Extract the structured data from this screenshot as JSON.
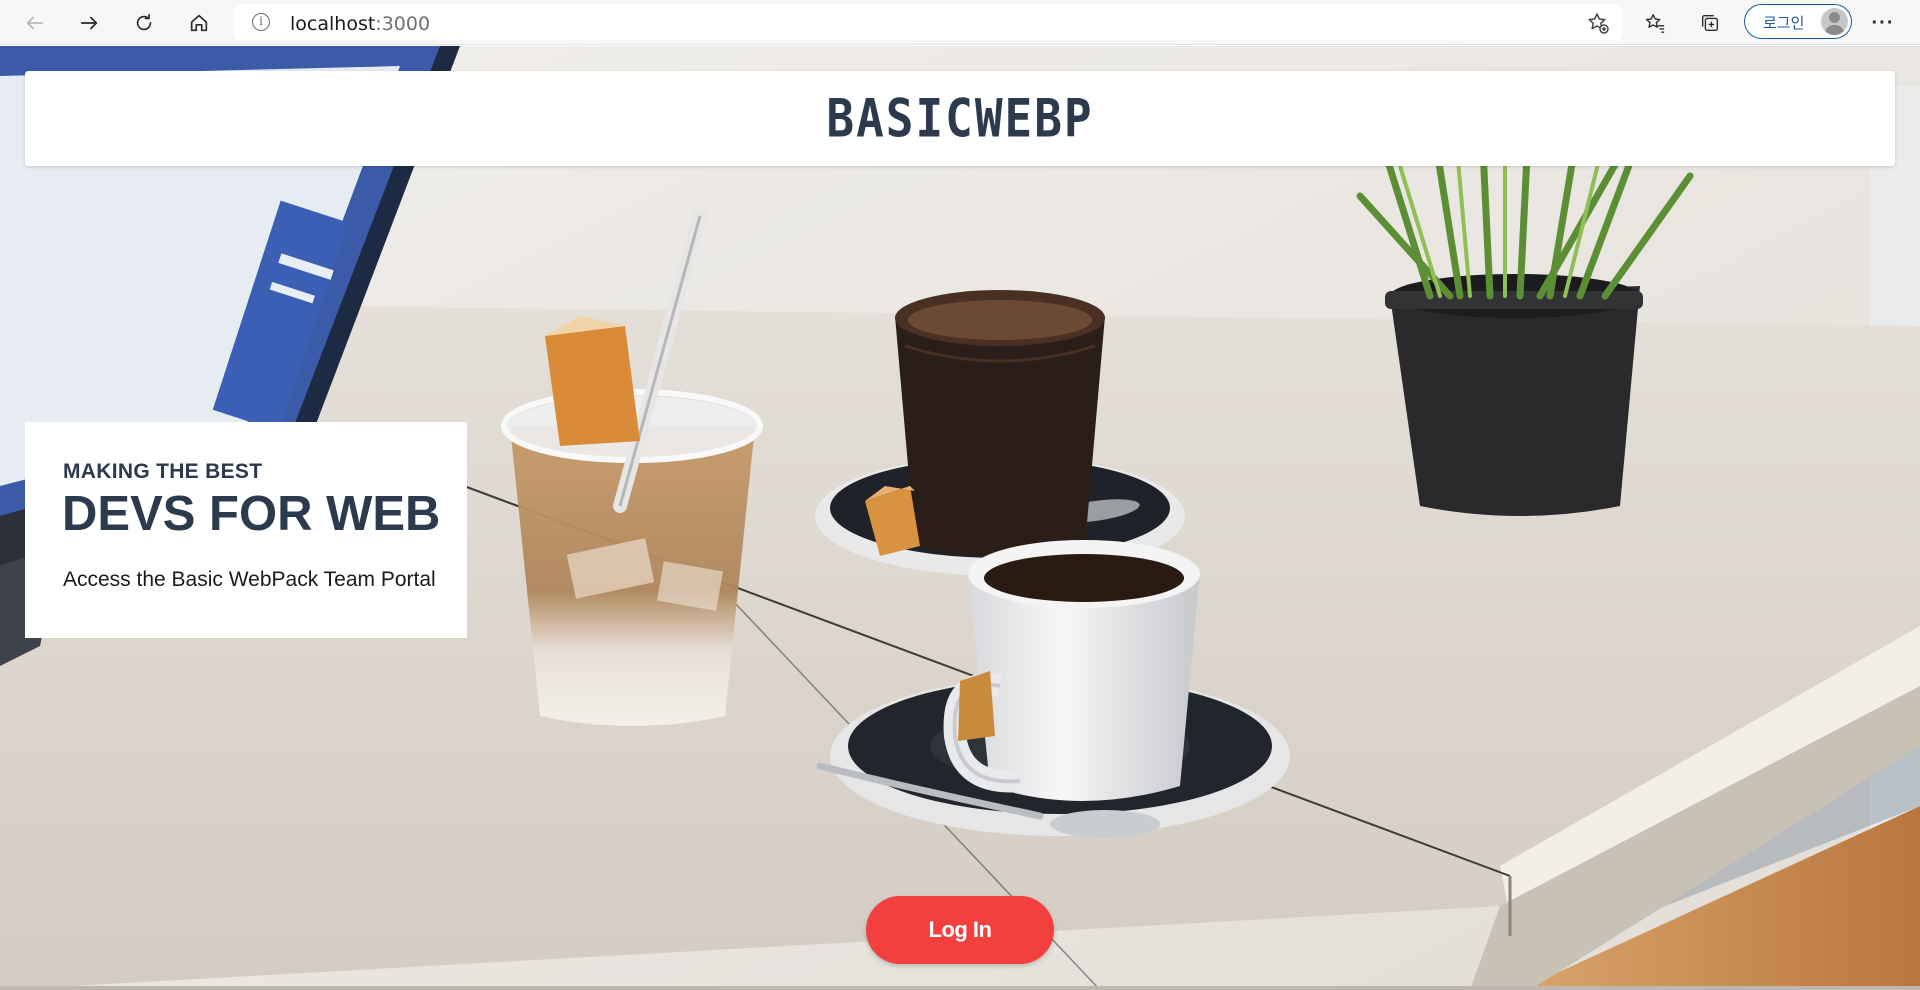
{
  "browser": {
    "back_icon": "arrow-left-icon",
    "forward_icon": "arrow-right-icon",
    "reload_icon": "refresh-icon",
    "home_icon": "home-icon",
    "url_host": "localhost",
    "url_port": ":3000",
    "profile_button_label": "로그인",
    "more_label": "···"
  },
  "site": {
    "logo": "BASICWEBP"
  },
  "hero": {
    "kicker": "MAKING THE BEST",
    "title": "DEVS FOR WEB",
    "subtitle": "Access the Basic WebPack Team Portal"
  },
  "actions": {
    "login_label": "Log In"
  },
  "colors": {
    "brand_dark": "#2c3a4e",
    "cta": "#f2403f",
    "profile_accent": "#1a5aa8"
  }
}
